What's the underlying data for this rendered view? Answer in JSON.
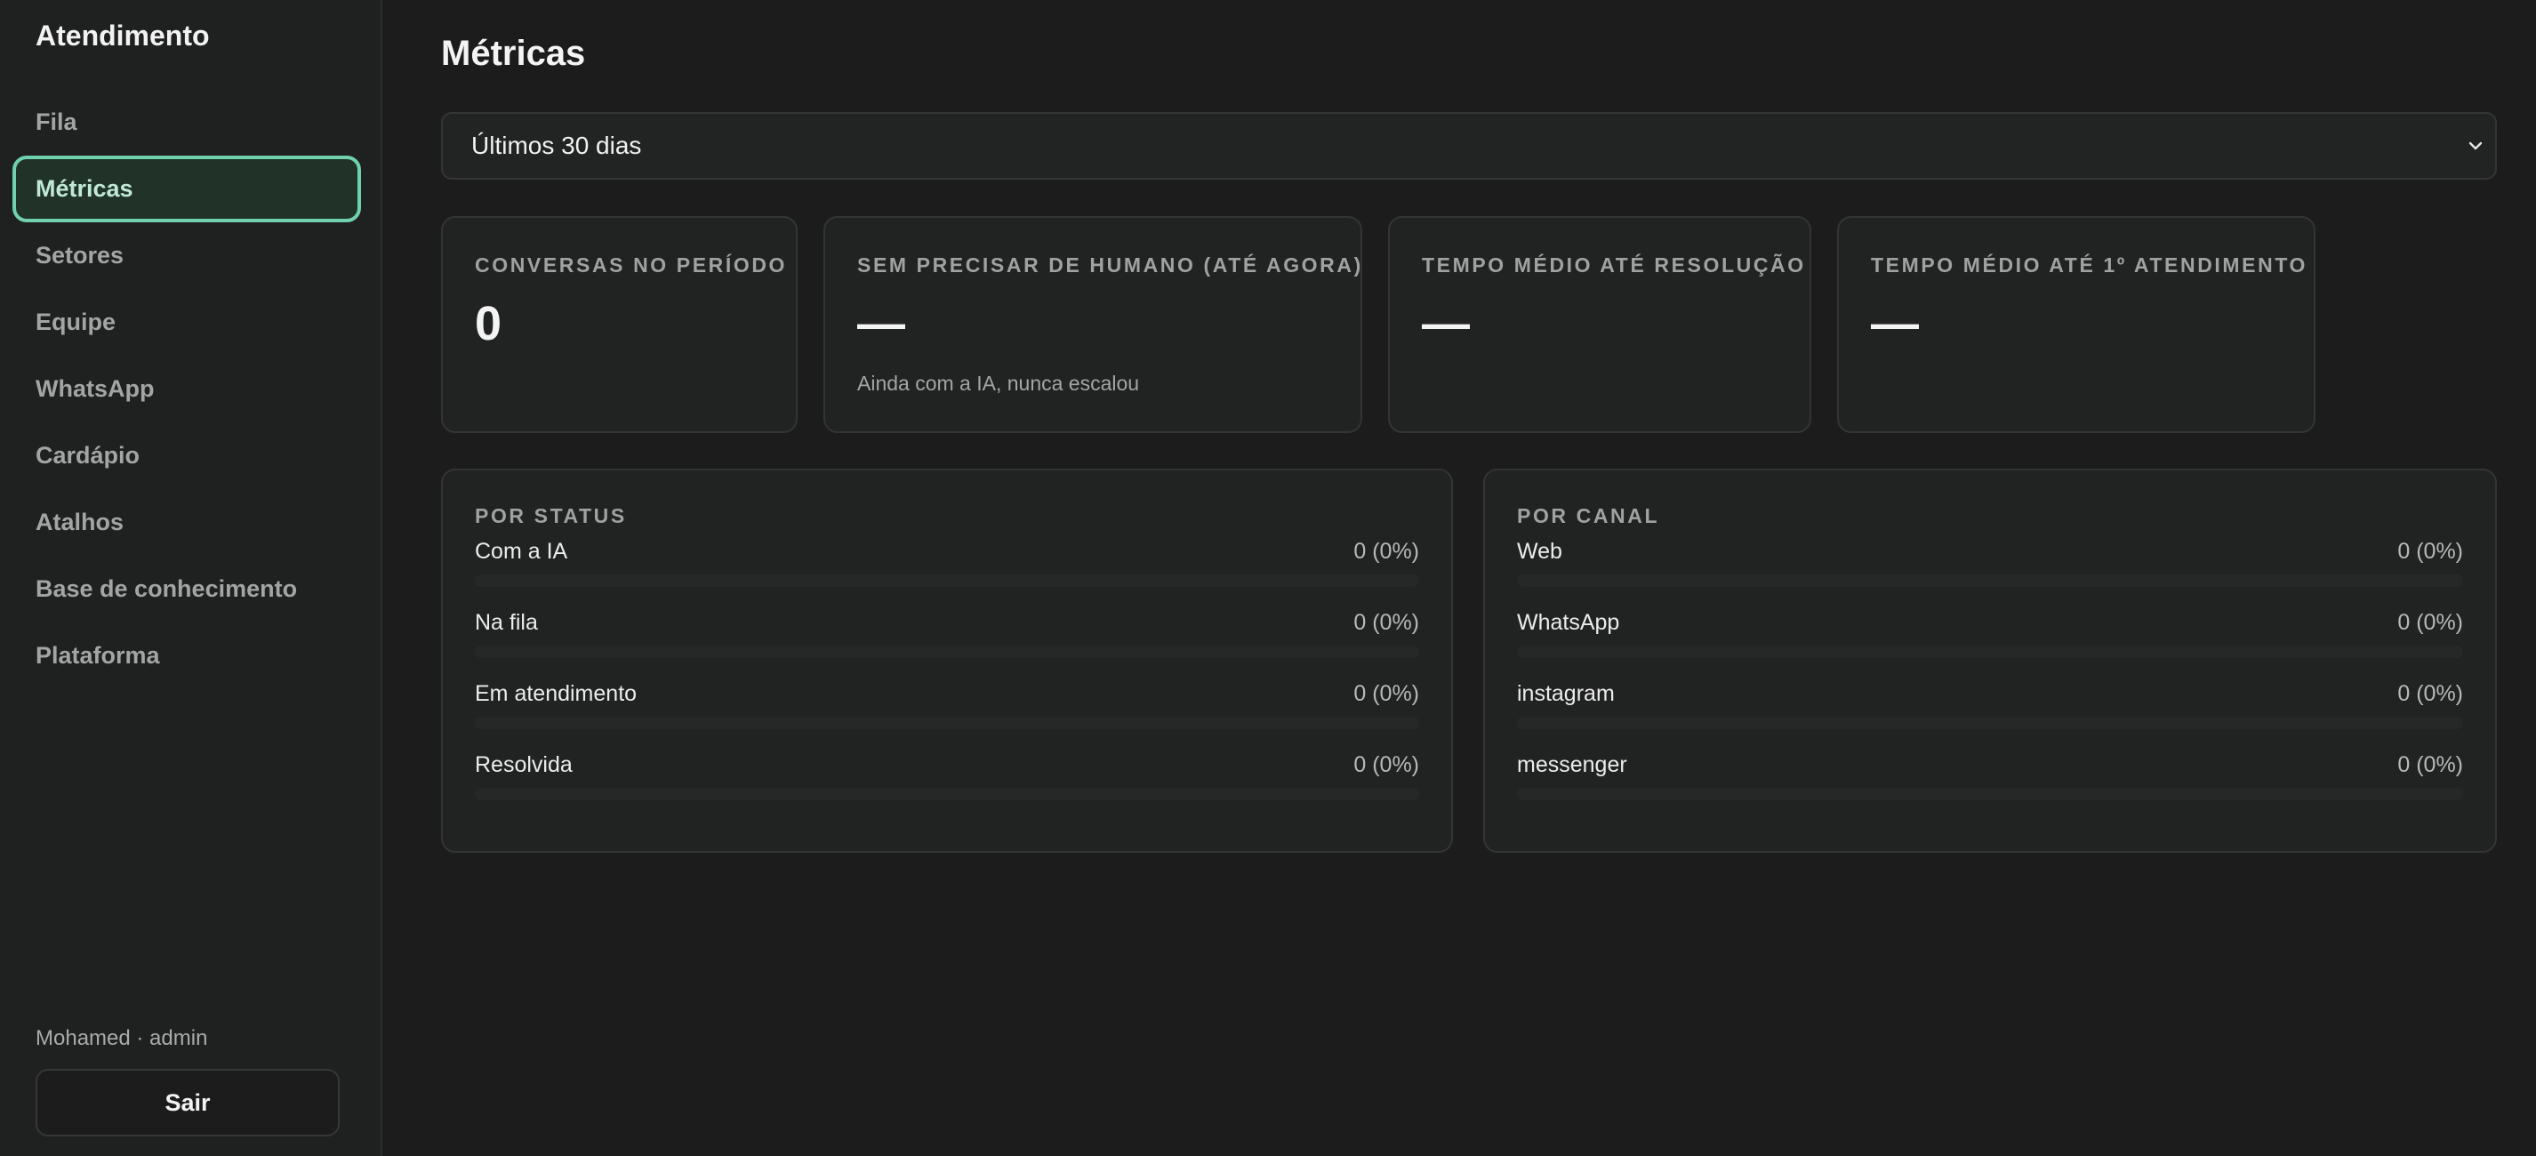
{
  "sidebar": {
    "title": "Atendimento",
    "items": [
      {
        "label": "Fila"
      },
      {
        "label": "Métricas",
        "active": true
      },
      {
        "label": "Setores"
      },
      {
        "label": "Equipe"
      },
      {
        "label": "WhatsApp"
      },
      {
        "label": "Cardápio"
      },
      {
        "label": "Atalhos"
      },
      {
        "label": "Base de conhecimento"
      },
      {
        "label": "Plataforma"
      }
    ],
    "user": "Mohamed · admin",
    "logout_label": "Sair"
  },
  "main": {
    "title": "Métricas",
    "period": {
      "selected": "Últimos 30 dias",
      "icon": "chevron-down-icon"
    },
    "kpis": [
      {
        "label": "CONVERSAS NO PERÍODO",
        "value": "0"
      },
      {
        "label": "SEM PRECISAR DE HUMANO (ATÉ AGORA)",
        "value": "—",
        "sub": "Ainda com a IA, nunca escalou"
      },
      {
        "label": "TEMPO MÉDIO ATÉ RESOLUÇÃO",
        "value": "—"
      },
      {
        "label": "TEMPO MÉDIO ATÉ 1º ATENDIMENTO",
        "value": "—"
      }
    ],
    "by_status": {
      "title": "POR STATUS",
      "rows": [
        {
          "label": "Com a IA",
          "value": "0 (0%)",
          "share": 0
        },
        {
          "label": "Na fila",
          "value": "0 (0%)",
          "share": 0
        },
        {
          "label": "Em atendimento",
          "value": "0 (0%)",
          "share": 0
        },
        {
          "label": "Resolvida",
          "value": "0 (0%)",
          "share": 0
        }
      ]
    },
    "by_channel": {
      "title": "POR CANAL",
      "rows": [
        {
          "label": "Web",
          "value": "0 (0%)",
          "share": 0
        },
        {
          "label": "WhatsApp",
          "value": "0 (0%)",
          "share": 0
        },
        {
          "label": "instagram",
          "value": "0 (0%)",
          "share": 0
        },
        {
          "label": "messenger",
          "value": "0 (0%)",
          "share": 0
        }
      ]
    }
  },
  "colors": {
    "accent": "#6fd1ae",
    "accent_bg": "#213229",
    "background": "#1c1c1c",
    "card": "#212222"
  }
}
